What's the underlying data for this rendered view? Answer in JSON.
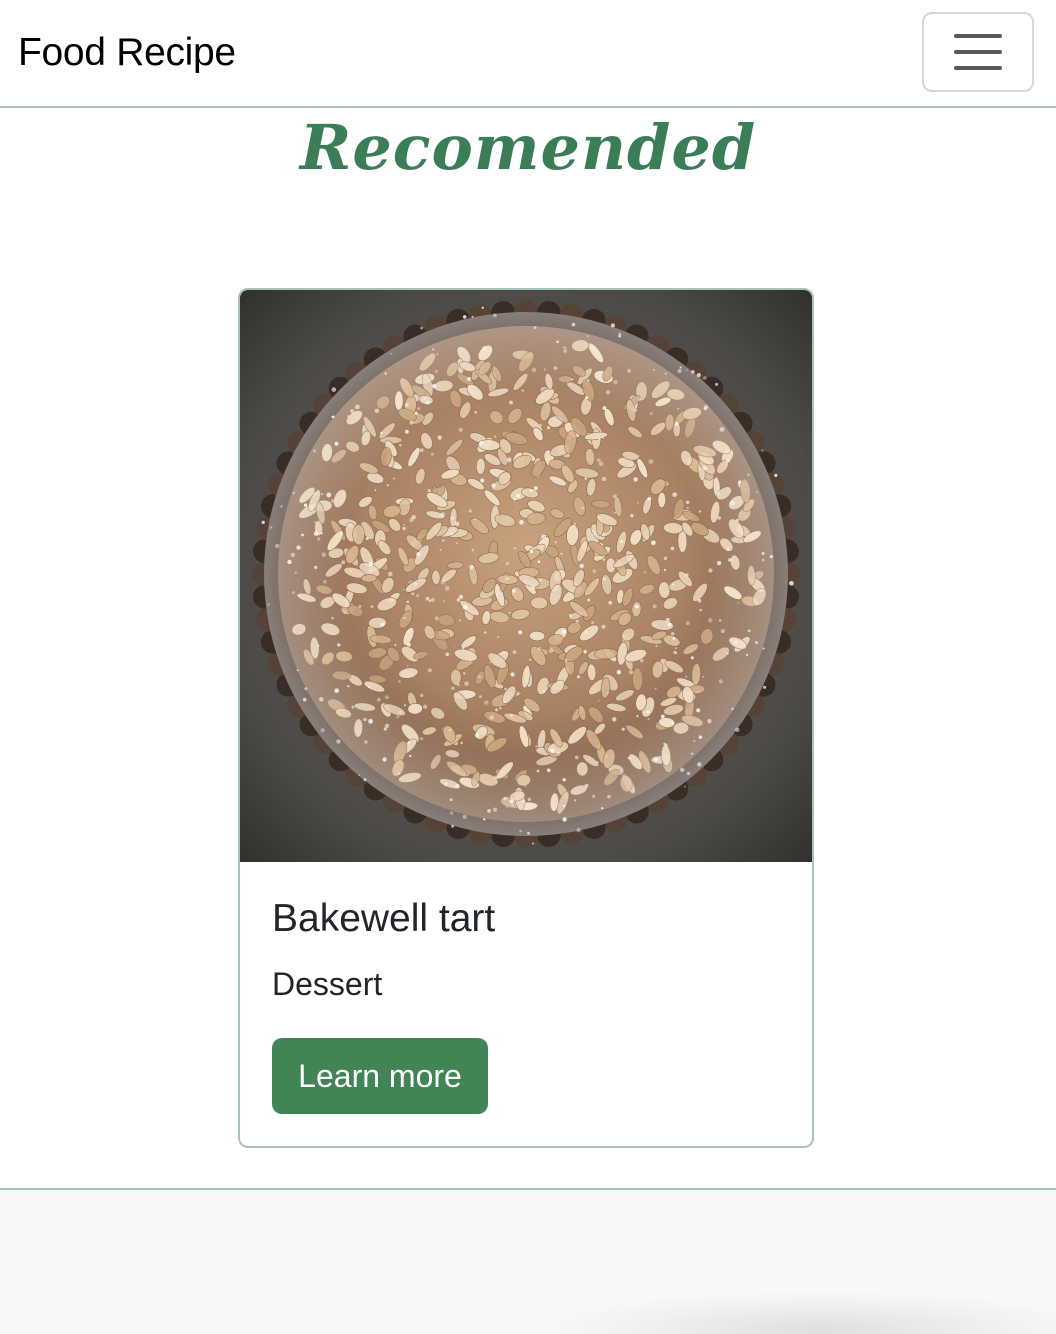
{
  "navbar": {
    "brand": "Food Recipe",
    "toggler_icon": "hamburger-menu-icon"
  },
  "section": {
    "title": "Recomended"
  },
  "recipes": [
    {
      "image": "bakewell-tart-photo",
      "title": "Bakewell tart",
      "category": "Dessert",
      "button_label": "Learn more"
    }
  ],
  "colors": {
    "accent": "#418556",
    "heading": "#3b7d57",
    "border": "#a9c4b6",
    "footer_bg": "#f7f8fa"
  }
}
